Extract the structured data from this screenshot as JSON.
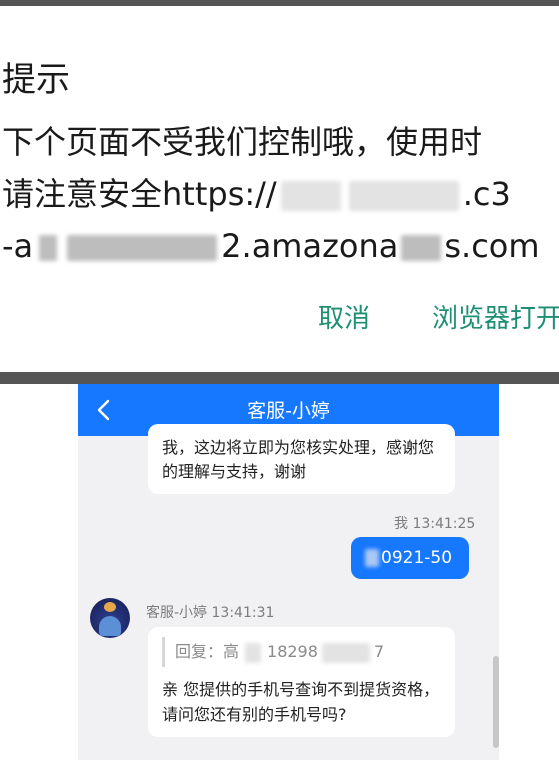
{
  "dialog": {
    "title": "提示",
    "line1": "下个页面不受我们控制哦，使用时",
    "line2_prefix": "请注意安全https://",
    "line2_tail": ".c3",
    "line3_prefix": "-a",
    "line3_mid": "2.amazona",
    "line3_tail": "s.com",
    "cancel_label": "取消",
    "open_browser_label": "浏览器打开"
  },
  "chat": {
    "header_title": "客服-小婷",
    "bubble1_text": "我，这边将立即为您核实处理，感谢您的理解与支持，谢谢",
    "my_meta": "我 13:41:25",
    "my_message": "0921-50",
    "agent_meta": "客服-小婷 13:41:31",
    "quote_prefix": "回复：高",
    "quote_number": "18298",
    "quote_tail": "7",
    "agent_reply": "亲 您提供的手机号查询不到提货资格，请问您还有别的手机号吗?"
  },
  "colors": {
    "accent_blue": "#1677ff",
    "button_green": "#1e8f74",
    "separator": "#555555"
  },
  "icons": {
    "back": "chevron-left-icon",
    "avatar": "agent-avatar"
  }
}
